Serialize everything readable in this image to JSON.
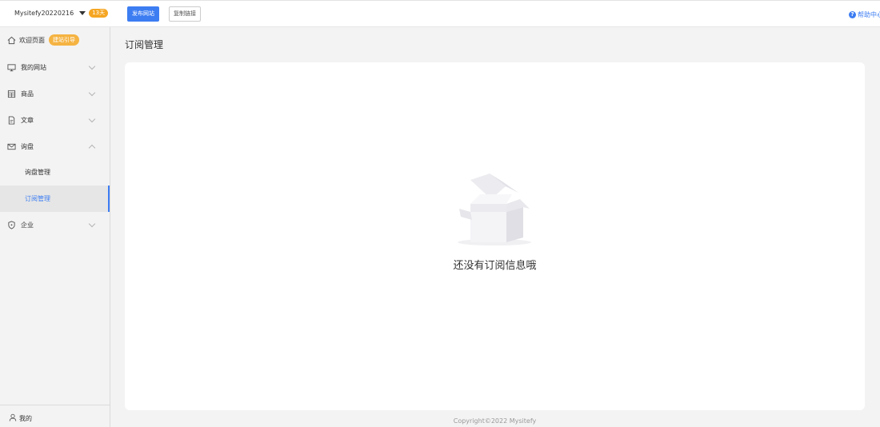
{
  "header": {
    "site_name": "Mysitefy20220216",
    "days_badge": "13天",
    "publish_label": "发布网站",
    "copy_link_label": "复制链接",
    "help_label": "帮助中心",
    "accent_color": "#3d7df2"
  },
  "sidebar": {
    "welcome": {
      "label": "欢迎页面",
      "badge": "建站引导"
    },
    "items": [
      {
        "label": "我的网站",
        "icon": "monitor-icon"
      },
      {
        "label": "商品",
        "icon": "grid-icon"
      },
      {
        "label": "文章",
        "icon": "document-icon"
      },
      {
        "label": "询盘",
        "icon": "mail-icon"
      },
      {
        "label": "企业",
        "icon": "shield-icon"
      }
    ],
    "inquiry_sub": [
      {
        "label": "询盘管理"
      },
      {
        "label": "订阅管理"
      }
    ],
    "profile_label": "我的"
  },
  "main": {
    "title": "订阅管理",
    "empty_text": "还没有订阅信息哦",
    "footer": "Copyright©2022 Mysitefy"
  }
}
